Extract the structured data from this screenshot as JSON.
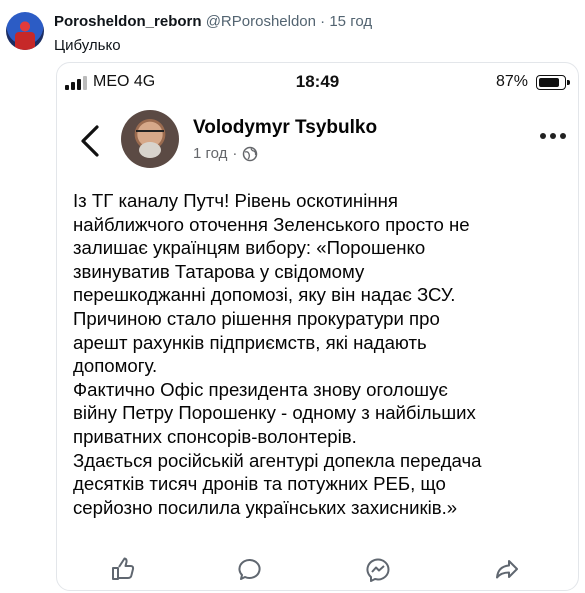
{
  "tweet": {
    "author_name": "Porosheldon_reborn",
    "author_handle": "@RPorosheldon",
    "separator": "·",
    "time": "15 год",
    "text": "Цибулько"
  },
  "phone": {
    "status_bar": {
      "carrier": "MEO  4G",
      "time": "18:49",
      "battery_percent": "87%",
      "battery_level": 0.87
    },
    "post": {
      "author": "Volodymyr Tsybulko",
      "time": "1 год",
      "separator": "·",
      "body": "Із ТГ каналу Путч! Рівень оскотиніння\nнайближчого оточення Зеленського просто не\nзалишає українцям вибору:  «Порошенко\nзвинуватив Татарова у свідомому\nперешкоджанні допомозі, яку він надає ЗСУ.\nПричиною стало рішення прокуратури про\nарешт рахунків підприємств, які надають\nдопомогу.\nФактично Офіс президента знову оголошує\nвійну Петру Порошенку - одному з найбільших\nприватних спонсорів-волонтерів.\nЗдається російській агентурі допекла передача\nдесятків тисяч дронів та потужних РЕБ, що\nсерйозно посилила українських захисників.»"
    },
    "icons": {
      "back": "chevron-left-icon",
      "privacy": "globe-icon",
      "more": "more-horizontal-icon",
      "actions": [
        "like-icon",
        "comment-icon",
        "messenger-icon",
        "share-icon"
      ]
    }
  }
}
